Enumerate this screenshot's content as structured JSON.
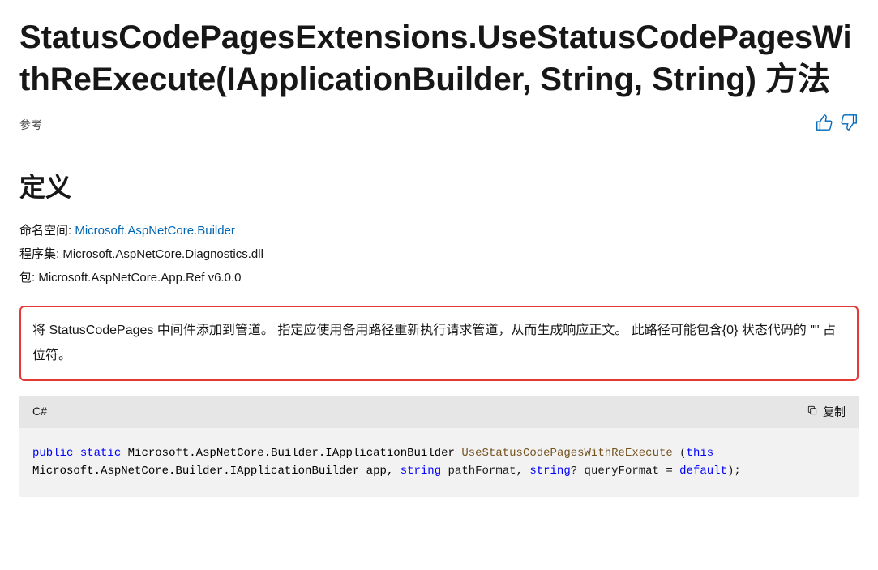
{
  "title_part1": "StatusCodePagesExtensions.UseStatusCodePagesWithReExecute(IApplicationBuilder, String, String) ",
  "title_part2": "方法",
  "reference_label": "参考",
  "definition_heading": "定义",
  "meta": {
    "namespace_label": "命名空间:",
    "namespace_value": "Microsoft.AspNetCore.Builder",
    "assembly_label": "程序集:",
    "assembly_value": "Microsoft.AspNetCore.Diagnostics.dll",
    "package_label": "包:",
    "package_value": "Microsoft.AspNetCore.App.Ref v6.0.0"
  },
  "description": "将 StatusCodePages 中间件添加到管道。 指定应使用备用路径重新执行请求管道，从而生成响应正文。 此路径可能包含{0} 状态代码的 \"\" 占位符。",
  "code": {
    "language": "C#",
    "copy_label": "复制",
    "tokens": {
      "kw_public": "public",
      "kw_static": "static",
      "type1": "Microsoft.AspNetCore.Builder.IApplicationBuilder",
      "method": "UseStatusCodePagesWithReExecute",
      "paren_open": " (",
      "kw_this": "this",
      "type2": "Microsoft.AspNetCore.Builder.IApplicationBuilder app, ",
      "kw_string1": "string",
      "param1": " pathFormat, ",
      "kw_string2": "string",
      "param2": "? queryFormat = ",
      "kw_default": "default",
      "end": ");"
    }
  }
}
